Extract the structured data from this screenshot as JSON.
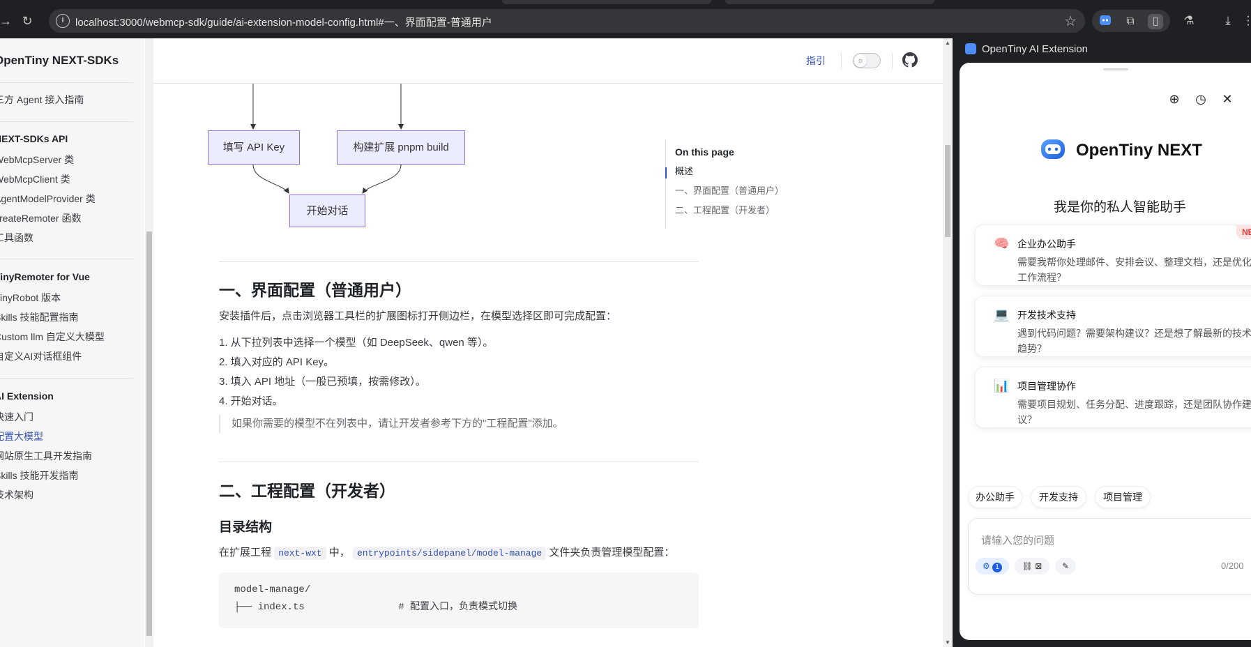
{
  "browser": {
    "url": "localhost:3000/webmcp-sdk/guide/ai-extension-model-config.html#一、界面配置-普通用户"
  },
  "sidebar": {
    "brand": "OpenTiny NEXT-SDKs",
    "items": [
      {
        "label": "三方 Agent 接入指南"
      },
      {
        "label": "NEXT-SDKs API",
        "heading": true
      },
      {
        "label": "WebMcpServer 类"
      },
      {
        "label": "WebMcpClient 类"
      },
      {
        "label": "AgentModelProvider 类"
      },
      {
        "label": "createRemoter 函数"
      },
      {
        "label": "工具函数"
      },
      {
        "label": "TinyRemoter for Vue",
        "heading": true
      },
      {
        "label": "TinyRobot 版本"
      },
      {
        "label": "Skills 技能配置指南"
      },
      {
        "label": "Custom llm 自定义大模型"
      },
      {
        "label": "自定义AI对话框组件"
      },
      {
        "label": "AI Extension",
        "heading": true
      },
      {
        "label": "快速入门"
      },
      {
        "label": "配置大模型",
        "active": true
      },
      {
        "label": "网站原生工具开发指南"
      },
      {
        "label": "Skills 技能开发指南"
      },
      {
        "label": "技术架构"
      }
    ]
  },
  "topnav": {
    "guide": "指引"
  },
  "flowchart": {
    "box1": "填写 API Key",
    "box2": "构建扩展 pnpm build",
    "box3": "开始对话"
  },
  "content": {
    "h2_ui": "一、界面配置（普通用户）",
    "intro": "安装插件后，点击浏览器工具栏的扩展图标打开侧边栏，在模型选择区即可完成配置：",
    "steps": [
      "1. 从下拉列表中选择一个模型（如 DeepSeek、qwen 等）。",
      "2. 填入对应的 API Key。",
      "3. 填入 API 地址（一般已预填，按需修改）。",
      "4. 开始对话。"
    ],
    "tip": "如果你需要的模型不在列表中，请让开发者参考下方的\"工程配置\"添加。",
    "h2_dev": "二、工程配置（开发者）",
    "h3_dir": "目录结构",
    "dir_pre": "在扩展工程",
    "dir_code1": "next-wxt",
    "dir_mid": "中，",
    "dir_code2": "entrypoints/sidepanel/model-manage",
    "dir_post": "文件夹负责管理模型配置：",
    "code_line1": "model-manage/",
    "code_line2": "├── index.ts                # 配置入口，负责模式切换"
  },
  "toc": {
    "title": "On this page",
    "items": [
      "概述",
      "一、界面配置（普通用户）",
      "二、工程配置（开发者）"
    ]
  },
  "panel": {
    "title": "OpenTiny AI Extension",
    "brand": "OpenTiny NEXT",
    "subtitle": "我是你的私人智能助手",
    "new_badge": "NEW",
    "cards": [
      {
        "icon": "🧠",
        "title": "企业办公助手",
        "desc": "需要我帮你处理邮件、安排会议、整理文档，还是优化工作流程？"
      },
      {
        "icon": "💻",
        "title": "开发技术支持",
        "desc": "遇到代码问题？需要架构建议？还是想了解最新的技术趋势？"
      },
      {
        "icon": "📊",
        "title": "项目管理协作",
        "desc": "需要项目规划、任务分配、进度跟踪，还是团队协作建议？"
      }
    ],
    "chips": [
      "办公助手",
      "开发支持",
      "项目管理"
    ],
    "input_placeholder": "请输入您的问题",
    "tool_count": "1",
    "char_counter": "0/200"
  }
}
